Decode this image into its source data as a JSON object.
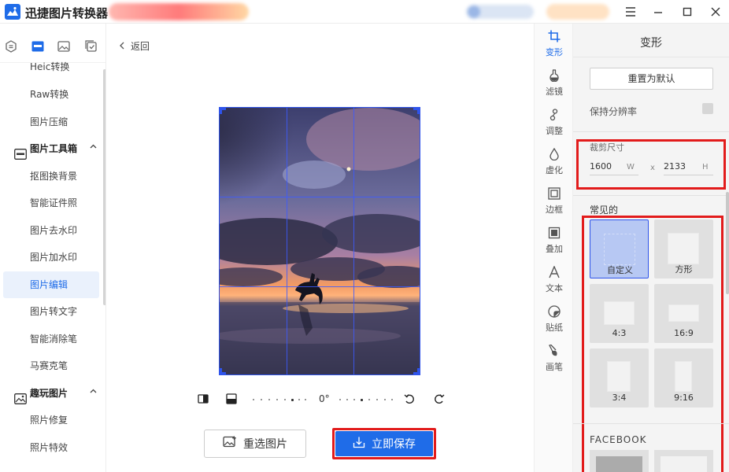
{
  "app": {
    "title": "迅捷图片转换器"
  },
  "sidebar": {
    "items": [
      {
        "label": "Heic转换"
      },
      {
        "label": "Raw转换"
      },
      {
        "label": "图片压缩"
      }
    ],
    "group_tools": {
      "label": "图片工具箱",
      "items": [
        {
          "label": "抠图换背景"
        },
        {
          "label": "智能证件照"
        },
        {
          "label": "图片去水印"
        },
        {
          "label": "图片加水印"
        },
        {
          "label": "图片编辑",
          "active": true
        },
        {
          "label": "图片转文字"
        },
        {
          "label": "智能消除笔"
        },
        {
          "label": "马赛克笔"
        }
      ]
    },
    "group_fun": {
      "label": "趣玩图片",
      "items": [
        {
          "label": "照片修复"
        },
        {
          "label": "照片特效"
        }
      ]
    }
  },
  "main": {
    "back_label": "返回",
    "rotation": "0°",
    "reselect_label": "重选图片",
    "save_label": "立即保存"
  },
  "toolstrip": [
    {
      "label": "变形",
      "icon": "crop-icon",
      "active": true
    },
    {
      "label": "滤镜",
      "icon": "filter-flask-icon"
    },
    {
      "label": "调整",
      "icon": "adjust-icon"
    },
    {
      "label": "虚化",
      "icon": "blur-drop-icon"
    },
    {
      "label": "边框",
      "icon": "frame-icon"
    },
    {
      "label": "叠加",
      "icon": "overlay-icon"
    },
    {
      "label": "文本",
      "icon": "text-icon"
    },
    {
      "label": "贴纸",
      "icon": "sticker-icon"
    },
    {
      "label": "画笔",
      "icon": "brush-icon"
    }
  ],
  "panel": {
    "title": "变形",
    "reset_label": "重置为默认",
    "keep_resolution_label": "保持分辨率",
    "crop_size_label": "裁剪尺寸",
    "width_value": "1600",
    "width_unit": "W",
    "times": "x",
    "height_value": "2133",
    "height_unit": "H",
    "common_label": "常见的",
    "presets": [
      {
        "label": "自定义",
        "selected": true
      },
      {
        "label": "方形"
      },
      {
        "label": "4:3"
      },
      {
        "label": "16:9"
      },
      {
        "label": "3:4"
      },
      {
        "label": "9:16"
      }
    ],
    "facebook_label": "FACEBOOK"
  },
  "colors": {
    "accent": "#1f6ce8",
    "highlight_outline": "#e21b1b",
    "crop_grid": "#2f54eb"
  }
}
